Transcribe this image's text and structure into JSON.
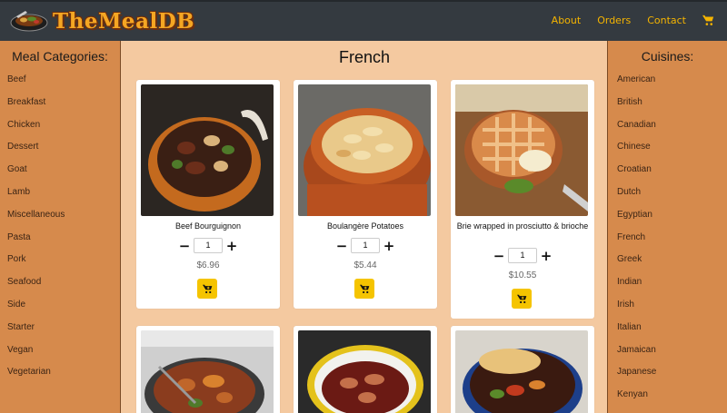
{
  "header": {
    "logo_text": "TheMealDB",
    "nav": [
      "About",
      "Orders",
      "Contact"
    ],
    "accent": "#f5b400",
    "bg": "#343a40",
    "cart_icon": "shopping-cart-icon"
  },
  "sidebar_left": {
    "title": "Meal Categories:",
    "items": [
      "Beef",
      "Breakfast",
      "Chicken",
      "Dessert",
      "Goat",
      "Lamb",
      "Miscellaneous",
      "Pasta",
      "Pork",
      "Seafood",
      "Side",
      "Starter",
      "Vegan",
      "Vegetarian"
    ]
  },
  "sidebar_right": {
    "title": "Cuisines:",
    "items": [
      "American",
      "British",
      "Canadian",
      "Chinese",
      "Croatian",
      "Dutch",
      "Egyptian",
      "French",
      "Greek",
      "Indian",
      "Irish",
      "Italian",
      "Jamaican",
      "Japanese",
      "Kenyan"
    ]
  },
  "main": {
    "title": "French",
    "meals": [
      {
        "name": "Beef Bourguignon",
        "qty": "1",
        "price": "$6.96"
      },
      {
        "name": "Boulangère Potatoes",
        "qty": "1",
        "price": "$5.44"
      },
      {
        "name": "Brie wrapped in prosciutto & brioche",
        "qty": "1",
        "price": "$10.55"
      }
    ]
  },
  "colors": {
    "sidebar": "#d68a4c",
    "main_bg": "#f4c9a0",
    "add_button": "#f5c400"
  }
}
